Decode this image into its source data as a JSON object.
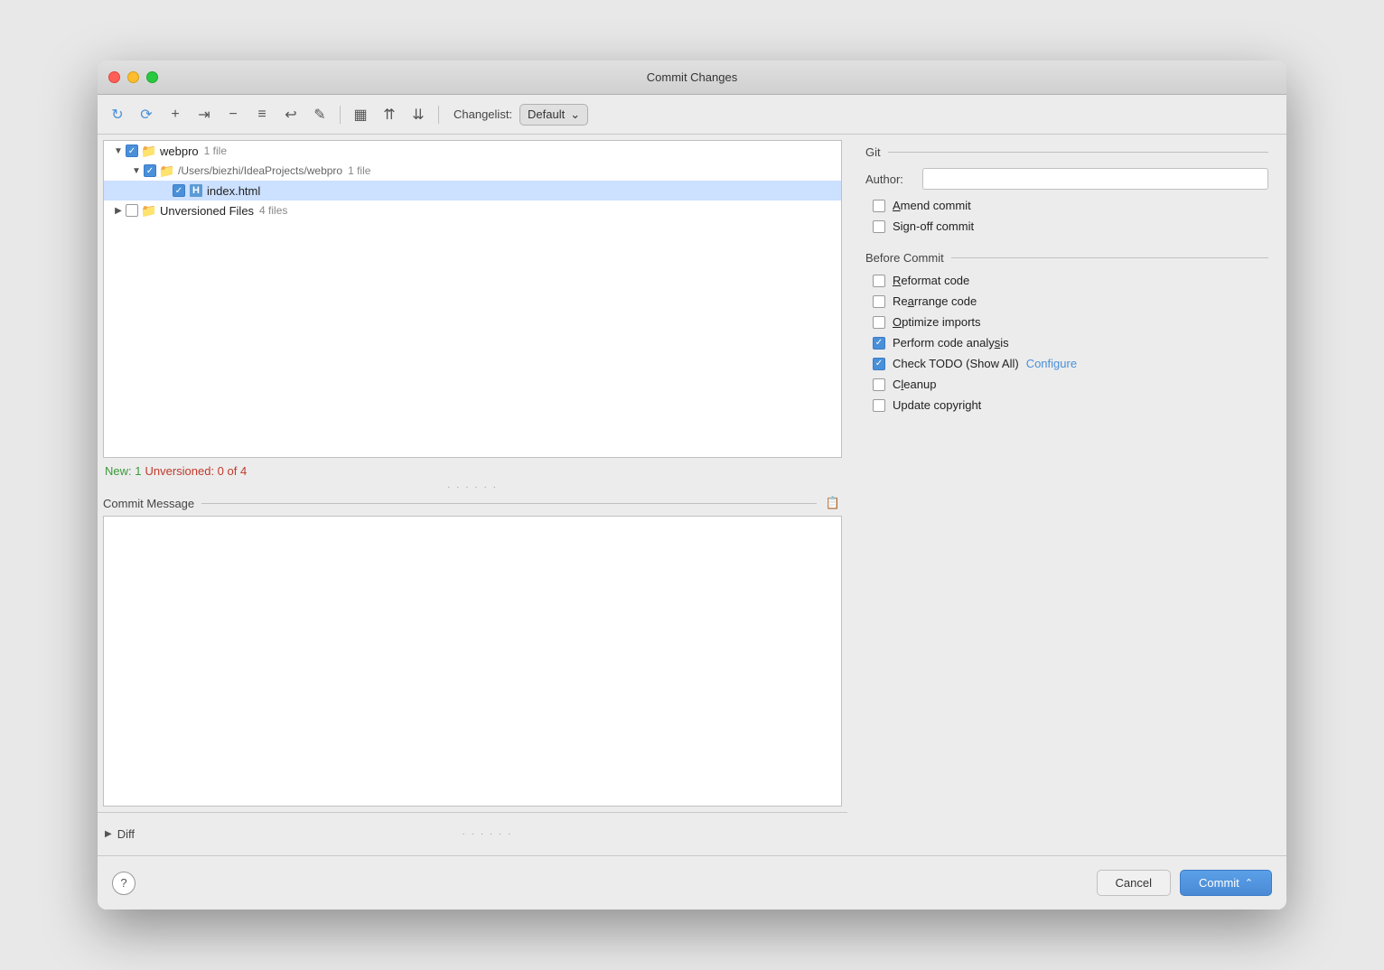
{
  "window": {
    "title": "Commit Changes"
  },
  "toolbar": {
    "changelist_label": "Changelist:",
    "changelist_value": "Default"
  },
  "git_section": {
    "header": "Git",
    "author_label": "Author:",
    "author_value": "",
    "amend_commit_label": "Amend commit",
    "signoff_commit_label": "Sign-off commit"
  },
  "before_commit": {
    "header": "Before Commit",
    "items": [
      {
        "label": "Reformat code",
        "checked": false,
        "underline_char": "R"
      },
      {
        "label": "Rearrange code",
        "checked": false,
        "underline_char": "a"
      },
      {
        "label": "Optimize imports",
        "checked": false,
        "underline_char": "O"
      },
      {
        "label": "Perform code analysis",
        "checked": true,
        "underline_char": "s"
      },
      {
        "label": "Check TODO (Show All)",
        "checked": true,
        "underline_char": null,
        "configure_link": "Configure"
      },
      {
        "label": "Cleanup",
        "checked": false,
        "underline_char": "l"
      },
      {
        "label": "Update copyright",
        "checked": false,
        "underline_char": null
      }
    ]
  },
  "file_tree": {
    "items": [
      {
        "level": 0,
        "type": "folder",
        "checked": true,
        "label": "webpro",
        "count": "1 file",
        "arrow": "▼"
      },
      {
        "level": 1,
        "type": "folder",
        "checked": true,
        "label": "/Users/biezhi/IdeaProjects/webpro",
        "count": "1 file",
        "arrow": "▼"
      },
      {
        "level": 2,
        "type": "file",
        "checked": true,
        "label": "index.html",
        "count": "",
        "arrow": "",
        "selected": true
      },
      {
        "level": 0,
        "type": "folder",
        "checked": false,
        "label": "Unversioned Files",
        "count": "4 files",
        "arrow": "▶"
      }
    ]
  },
  "status": {
    "new_label": "New: 1",
    "unversioned_label": "Unversioned: 0 of 4"
  },
  "commit_message": {
    "label": "Commit Message"
  },
  "diff": {
    "label": "Diff"
  },
  "buttons": {
    "help": "?",
    "cancel": "Cancel",
    "commit": "Commit"
  }
}
